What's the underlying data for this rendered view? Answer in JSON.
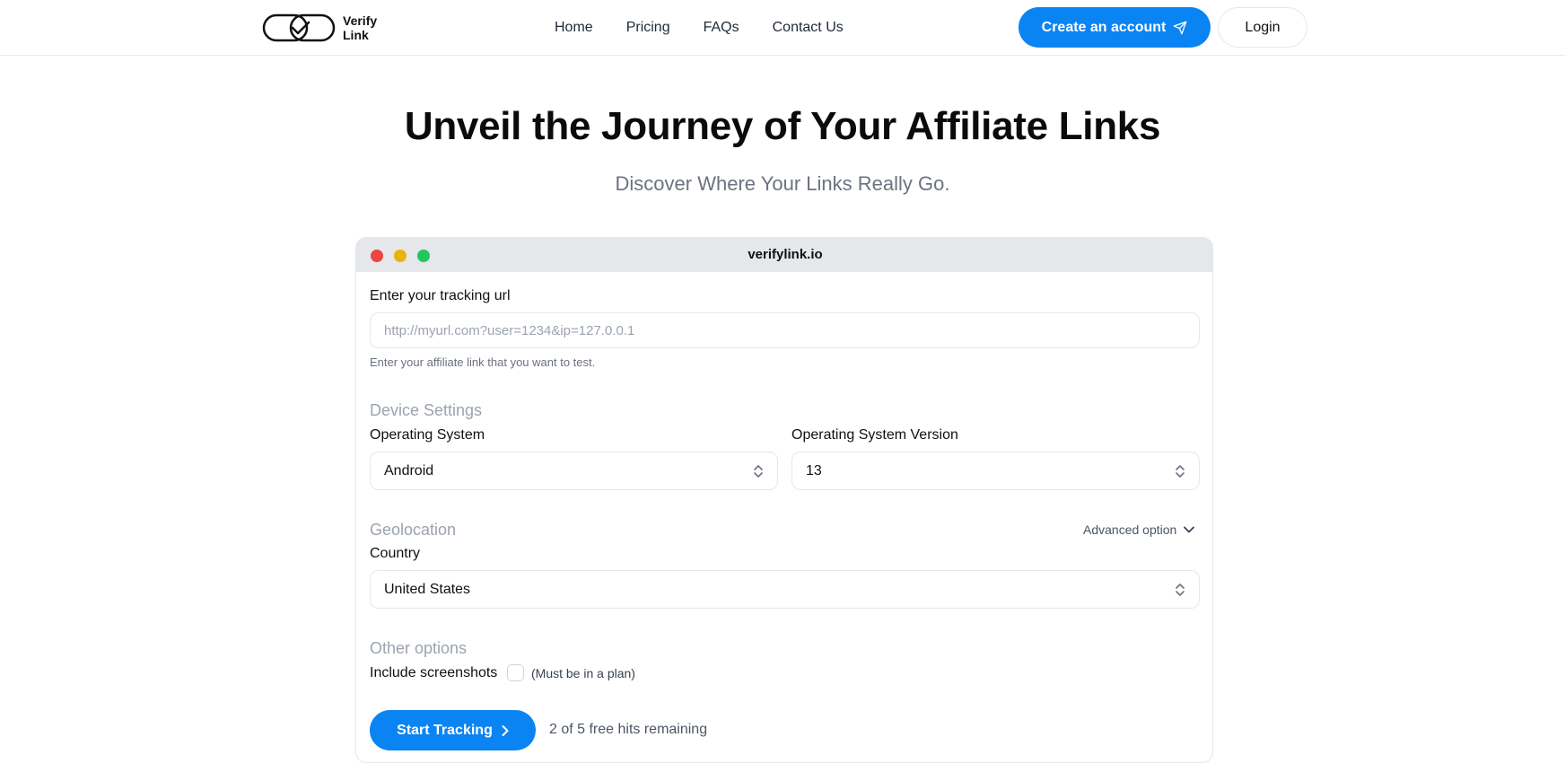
{
  "header": {
    "logo_line1": "Verify",
    "logo_line2": "Link",
    "nav": [
      "Home",
      "Pricing",
      "FAQs",
      "Contact Us"
    ],
    "create_account_label": "Create an account",
    "login_label": "Login"
  },
  "hero": {
    "title": "Unveil the Journey of Your Affiliate Links",
    "subtitle": "Discover Where Your Links Really Go."
  },
  "card": {
    "domain": "verifylink.io",
    "tracking_label": "Enter your tracking url",
    "tracking_placeholder": "http://myurl.com?user=1234&ip=127.0.0.1",
    "tracking_hint": "Enter your affiliate link that you want to test.",
    "device_section": "Device Settings",
    "os_label": "Operating System",
    "os_value": "Android",
    "os_version_label": "Operating System Version",
    "os_version_value": "13",
    "geo_section": "Geolocation",
    "advanced_option": "Advanced option",
    "country_label": "Country",
    "country_value": "United States",
    "other_section": "Other options",
    "screenshots_label": "Include screenshots",
    "screenshots_note": "(Must be in a plan)",
    "start_label": "Start Tracking",
    "hits_remaining": "2 of 5 free hits remaining"
  },
  "colors": {
    "accent": "#0b84f3",
    "window_red": "#ef4444",
    "window_yellow": "#eab308",
    "window_green": "#22c55e"
  },
  "icons": [
    "link-check-logo-icon",
    "send-icon",
    "chevron-updown-icon",
    "chevron-down-icon",
    "chevron-right-icon"
  ]
}
